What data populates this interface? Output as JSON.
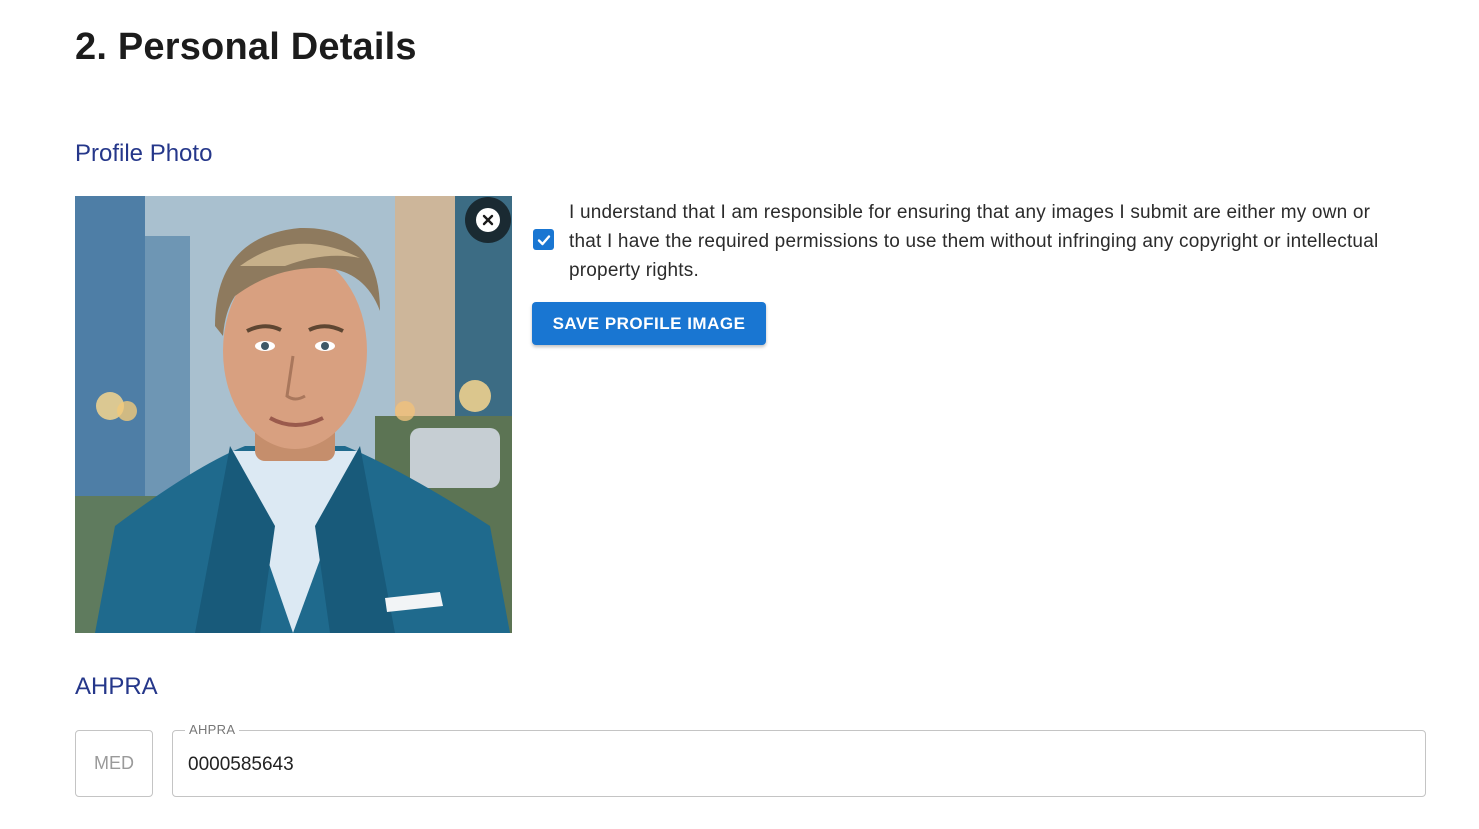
{
  "page": {
    "title": "2. Personal Details"
  },
  "profile_photo": {
    "section_title": "Profile Photo",
    "consent_checked": true,
    "consent_text": "I understand that I am responsible for ensuring that any images I submit are either my own or that I have the required permissions to use them without infringing any copyright or intellectual property rights.",
    "save_label": "SAVE PROFILE IMAGE"
  },
  "ahpra": {
    "section_title": "AHPRA",
    "prefix": "MED",
    "field_label": "AHPRA",
    "value": "0000585643"
  },
  "colors": {
    "accent": "#1976d2",
    "section_heading": "#25378a"
  },
  "icons": {
    "remove_photo": "close-icon",
    "consent": "check-icon"
  }
}
